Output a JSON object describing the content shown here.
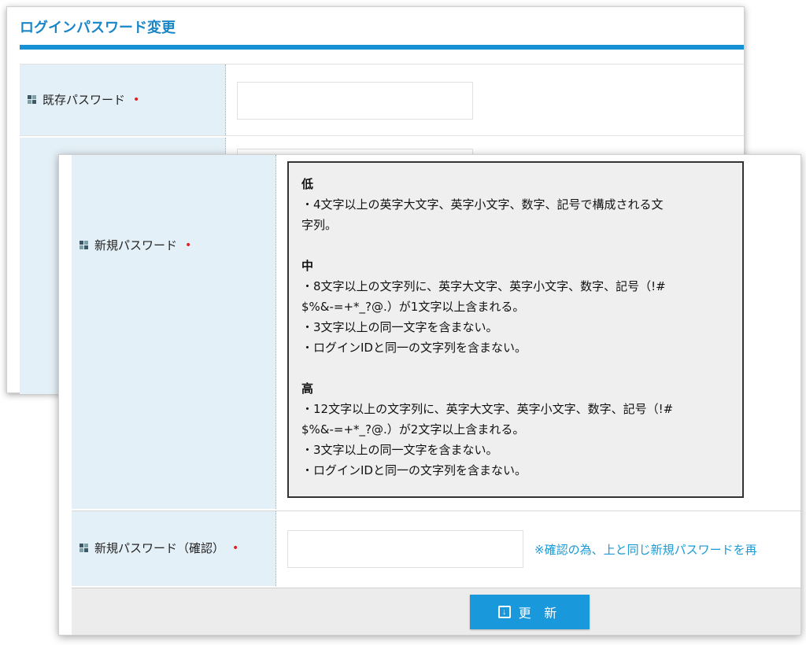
{
  "page": {
    "title": "ログインパスワード変更"
  },
  "fields": {
    "current_password": {
      "label": "既存パスワード",
      "required_mark": "•",
      "value": ""
    },
    "new_password": {
      "label": "新規パスワード",
      "required_mark": "•"
    },
    "confirm_password": {
      "label": "新規パスワード（確認）",
      "required_mark": "•",
      "value": "",
      "note": "※確認の為、上と同じ新規パスワードを再"
    }
  },
  "strength": {
    "low": {
      "title": "低",
      "rules": [
        "・4文字以上の英字大文字、英字小文字、数字、記号で構成される文\n字列。"
      ]
    },
    "mid": {
      "title": "中",
      "rules": [
        "・8文字以上の文字列に、英字大文字、英字小文字、数字、記号（!#\n$%&-=+*_?@.）が1文字以上含まれる。",
        "・3文字以上の同一文字を含まない。",
        "・ログインIDと同一の文字列を含まない。"
      ]
    },
    "high": {
      "title": "高",
      "rules": [
        "・12文字以上の文字列に、英字大文字、英字小文字、数字、記号（!#\n$%&-=+*_?@.）が2文字以上含まれる。",
        "・3文字以上の同一文字を含まない。",
        "・ログインIDと同一の文字列を含まない。"
      ]
    }
  },
  "footer": {
    "update_label": "更 新",
    "update_icon": "download-icon"
  }
}
